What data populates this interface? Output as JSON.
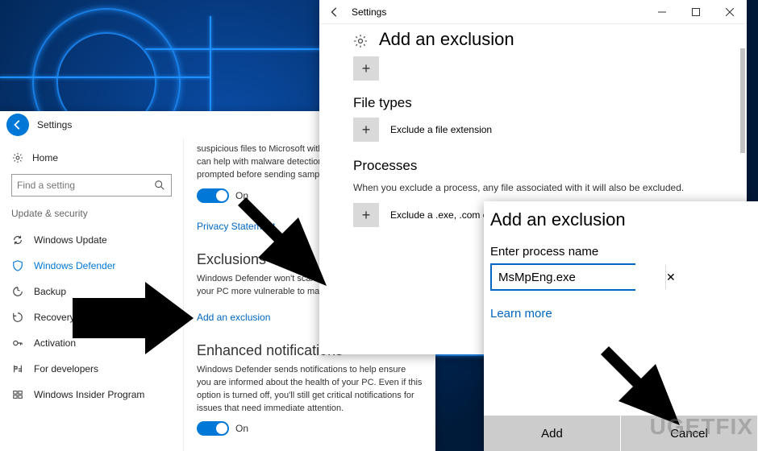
{
  "left": {
    "title": "Settings",
    "home": "Home",
    "search_placeholder": "Find a setting",
    "category": "Update & security",
    "items": [
      {
        "icon": "sync",
        "label": "Windows Update"
      },
      {
        "icon": "shield",
        "label": "Windows Defender"
      },
      {
        "icon": "backup",
        "label": "Backup"
      },
      {
        "icon": "recovery",
        "label": "Recovery"
      },
      {
        "icon": "key",
        "label": "Activation"
      },
      {
        "icon": "dev",
        "label": "For developers"
      },
      {
        "icon": "insider",
        "label": "Windows Insider Program"
      }
    ],
    "main": {
      "para1": "suspicious files to Microsoft without prompting you. This can help with malware detection. Turn this off to be prompted before sending samples to Microsoft.",
      "toggle1": "On",
      "privacy_link": "Privacy Statement",
      "exclusions_heading": "Exclusions",
      "exclusions_text": "Windows Defender won't scan excluded files, making your PC more vulnerable to malware.",
      "add_exclusion_link": "Add an exclusion",
      "enhanced_heading": "Enhanced notifications",
      "enhanced_text": "Windows Defender sends notifications to help ensure you are informed about the health of your PC. Even if this option is turned off, you'll still get critical notifications for issues that need immediate attention.",
      "toggle2": "On"
    }
  },
  "mid": {
    "title": "Settings",
    "heading": "Add an exclusion",
    "filetypes_heading": "File types",
    "filetypes_row": "Exclude a file extension",
    "processes_heading": "Processes",
    "processes_text": "When you exclude a process, any file associated with it will also be excluded.",
    "processes_row": "Exclude a .exe, .com or .scr process"
  },
  "right": {
    "heading": "Add an exclusion",
    "label": "Enter process name",
    "value": "MsMpEng.exe",
    "learn": "Learn more",
    "add": "Add",
    "cancel": "Cancel"
  },
  "watermark": "UGETFIX"
}
